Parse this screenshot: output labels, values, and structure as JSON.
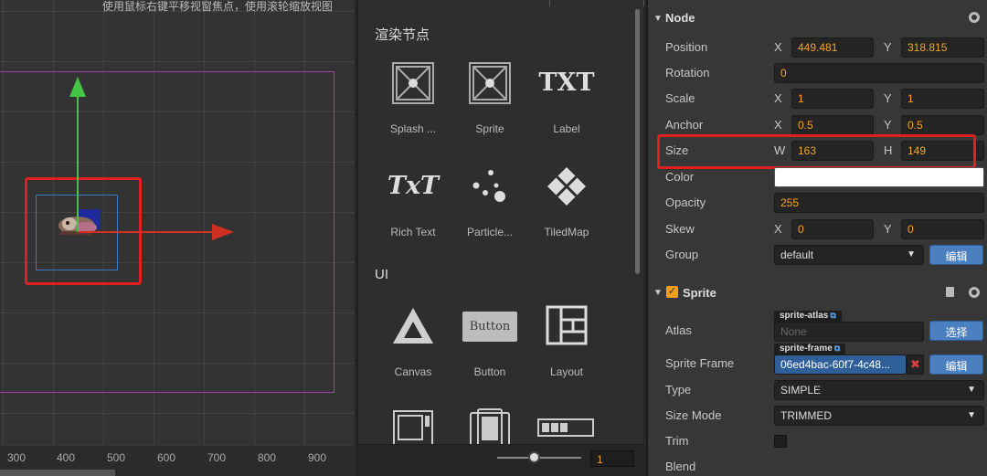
{
  "scene": {
    "hint": "使用鼠标右键平移视窗焦点，使用滚轮缩放视图",
    "ruler_ticks": [
      "300",
      "400",
      "500",
      "600",
      "700",
      "800",
      "900"
    ]
  },
  "library": {
    "section_render": "渲染节点",
    "section_ui": "UI",
    "render_items": [
      {
        "label": "Splash ...",
        "icon": "splash-icon"
      },
      {
        "label": "Sprite",
        "icon": "sprite-icon"
      },
      {
        "label": "Label",
        "icon": "label-icon"
      },
      {
        "label": "Rich Text",
        "icon": "rich-text-icon"
      },
      {
        "label": "Particle...",
        "icon": "particle-icon"
      },
      {
        "label": "TiledMap",
        "icon": "tiledmap-icon"
      }
    ],
    "ui_items": [
      {
        "label": "Canvas",
        "icon": "canvas-icon"
      },
      {
        "label": "Button",
        "icon": "button-icon"
      },
      {
        "label": "Layout",
        "icon": "layout-icon"
      }
    ],
    "label_glyph": "TXT",
    "richtext_glyph": "TxT",
    "button_glyph": "Button",
    "zoom_value": "1"
  },
  "props": {
    "node_header": "Node",
    "position": {
      "label": "Position",
      "x_axis": "X",
      "x": "449.481",
      "y_axis": "Y",
      "y": "318.815"
    },
    "rotation": {
      "label": "Rotation",
      "value": "0"
    },
    "scale": {
      "label": "Scale",
      "x_axis": "X",
      "x": "1",
      "y_axis": "Y",
      "y": "1"
    },
    "anchor": {
      "label": "Anchor",
      "x_axis": "X",
      "x": "0.5",
      "y_axis": "Y",
      "y": "0.5"
    },
    "size": {
      "label": "Size",
      "w_axis": "W",
      "w": "163",
      "h_axis": "H",
      "h": "149"
    },
    "color": {
      "label": "Color",
      "value": "#ffffff"
    },
    "opacity": {
      "label": "Opacity",
      "value": "255"
    },
    "skew": {
      "label": "Skew",
      "x_axis": "X",
      "x": "0",
      "y_axis": "Y",
      "y": "0"
    },
    "group": {
      "label": "Group",
      "value": "default",
      "edit": "编辑"
    },
    "sprite_header": "Sprite",
    "atlas": {
      "label": "Atlas",
      "tag": "sprite-atlas",
      "placeholder": "None",
      "action": "选择"
    },
    "sprite_frame": {
      "label": "Sprite Frame",
      "tag": "sprite-frame",
      "value": "06ed4bac-60f7-4c48...",
      "action": "编辑"
    },
    "type": {
      "label": "Type",
      "value": "SIMPLE"
    },
    "size_mode": {
      "label": "Size Mode",
      "value": "TRIMMED"
    },
    "trim": {
      "label": "Trim"
    },
    "blend": {
      "label": "Blend"
    }
  },
  "colors": {
    "accent_orange": "#f5a623",
    "button_blue": "#4a7fc0",
    "highlight_red": "#e02020",
    "gizmo_green": "#45c545",
    "gizmo_red": "#d03020"
  }
}
